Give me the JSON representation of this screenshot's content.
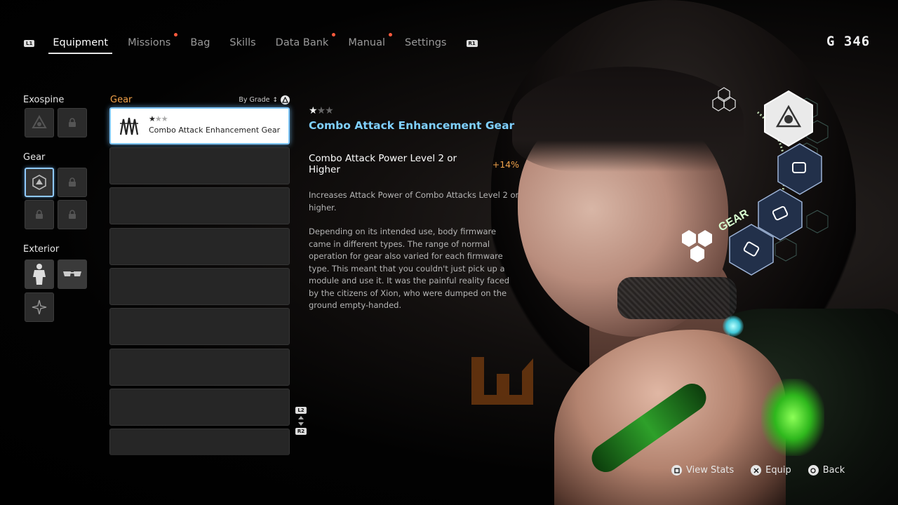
{
  "nav": {
    "left_button": "L1",
    "right_button": "R1",
    "tabs": [
      {
        "label": "Equipment",
        "active": true,
        "badge": false
      },
      {
        "label": "Missions",
        "active": false,
        "badge": true
      },
      {
        "label": "Bag",
        "active": false,
        "badge": false
      },
      {
        "label": "Skills",
        "active": false,
        "badge": false
      },
      {
        "label": "Data Bank",
        "active": false,
        "badge": true
      },
      {
        "label": "Manual",
        "active": false,
        "badge": true
      },
      {
        "label": "Settings",
        "active": false,
        "badge": false
      }
    ]
  },
  "currency": {
    "symbol": "G",
    "amount": "346"
  },
  "categories": {
    "exospine": "Exospine",
    "gear": "Gear",
    "exterior": "Exterior"
  },
  "gear_list": {
    "title": "Gear",
    "sort_label": "By Grade",
    "selected_item": {
      "grade": 1,
      "max_grade": 3,
      "stars": "★",
      "dim_stars": "★★",
      "name": "Combo Attack Enhancement Gear"
    },
    "scroll_up_button": "L2",
    "scroll_down_button": "R2"
  },
  "detail": {
    "stars": "★",
    "dim_stars": "★★",
    "title": "Combo Attack Enhancement Gear",
    "stat_label": "Combo Attack Power Level 2 or Higher",
    "stat_value": "+14%",
    "desc_1": "Increases Attack Power of Combo Attacks Level 2 or higher.",
    "desc_2": "Depending on its intended use, body firmware came in different types. The range of normal operation for gear also varied for each firmware type. This meant that you couldn't just pick up a module and use it. It was the painful reality faced by the citizens of Xion, who were dumped on the ground empty-handed."
  },
  "wheel": {
    "label": "GEAR"
  },
  "prompts": {
    "view_stats": "View Stats",
    "equip": "Equip",
    "back": "Back"
  },
  "colors": {
    "accent_blue": "#7fd0ff",
    "accent_orange": "#f2a24a",
    "badge_red": "#ff5a3c",
    "glow_green": "#8cff57"
  }
}
